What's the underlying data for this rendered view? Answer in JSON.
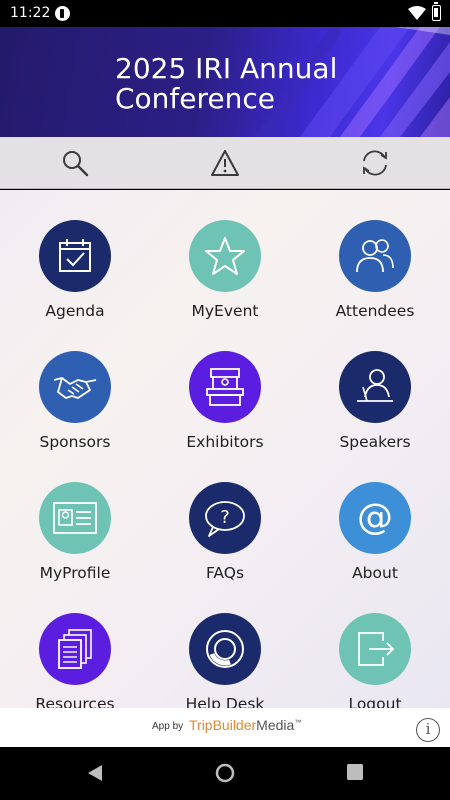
{
  "status_bar": {
    "time": "11:22"
  },
  "banner": {
    "title_line1": "2025 IRI Annual",
    "title_line2": "Conference"
  },
  "toolbar": {
    "icons": [
      "search-icon",
      "alert-icon",
      "sync-icon"
    ]
  },
  "tiles": [
    {
      "label": "Agenda",
      "color": "#1b2a6b",
      "icon": "calendar-icon"
    },
    {
      "label": "MyEvent",
      "color": "#6ec3b4",
      "icon": "star-icon"
    },
    {
      "label": "Attendees",
      "color": "#2f5fb0",
      "icon": "people-icon"
    },
    {
      "label": "Sponsors",
      "color": "#2f5fb0",
      "icon": "handshake-icon"
    },
    {
      "label": "Exhibitors",
      "color": "#5b1ee0",
      "icon": "booth-icon"
    },
    {
      "label": "Speakers",
      "color": "#1b2a6b",
      "icon": "speaker-icon"
    },
    {
      "label": "MyProfile",
      "color": "#6ec3b4",
      "icon": "id-card-icon"
    },
    {
      "label": "FAQs",
      "color": "#1b2a6b",
      "icon": "question-bubble-icon"
    },
    {
      "label": "About",
      "color": "#3d8fd8",
      "icon": "at-icon"
    },
    {
      "label": "Resources",
      "color": "#5b1ee0",
      "icon": "documents-icon"
    },
    {
      "label": "Help Desk",
      "color": "#1b2a6b",
      "icon": "lifebuoy-icon"
    },
    {
      "label": "Logout",
      "color": "#6ec3b4",
      "icon": "logout-icon"
    }
  ],
  "footer": {
    "app_by": "App by",
    "brand_trip": "TripBuilder",
    "brand_media": "Media",
    "tm": "™"
  }
}
